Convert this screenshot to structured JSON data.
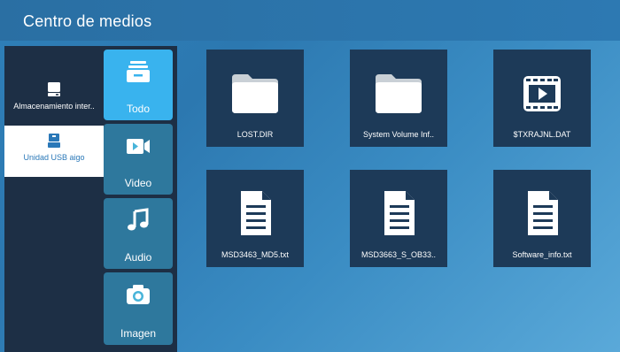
{
  "title": "Centro de medios",
  "storage": [
    {
      "label": "Almacenamiento inter..",
      "icon": "hard-drive-icon"
    },
    {
      "label": "Unidad USB aigo",
      "icon": "usb-drive-icon"
    }
  ],
  "categories": [
    {
      "label": "Todo",
      "icon": "all-files-icon"
    },
    {
      "label": "Video",
      "icon": "video-camera-icon"
    },
    {
      "label": "Audio",
      "icon": "music-note-icon"
    },
    {
      "label": "Imagen",
      "icon": "camera-icon"
    }
  ],
  "files": [
    {
      "label": "LOST.DIR",
      "icon": "folder-icon"
    },
    {
      "label": "System Volume Inf..",
      "icon": "folder-icon"
    },
    {
      "label": "$TXRAJNL.DAT",
      "icon": "video-file-icon"
    },
    {
      "label": "MSD3463_MD5.txt",
      "icon": "document-icon"
    },
    {
      "label": "MSD3663_S_OB33..",
      "icon": "document-icon"
    },
    {
      "label": "Software_info.txt",
      "icon": "document-icon"
    }
  ],
  "colors": {
    "background": "#2f7fb8",
    "panel": "#1d2f45",
    "tile": "#1d3a58",
    "accent": "#39b3ee",
    "selected": "#ffffff"
  }
}
